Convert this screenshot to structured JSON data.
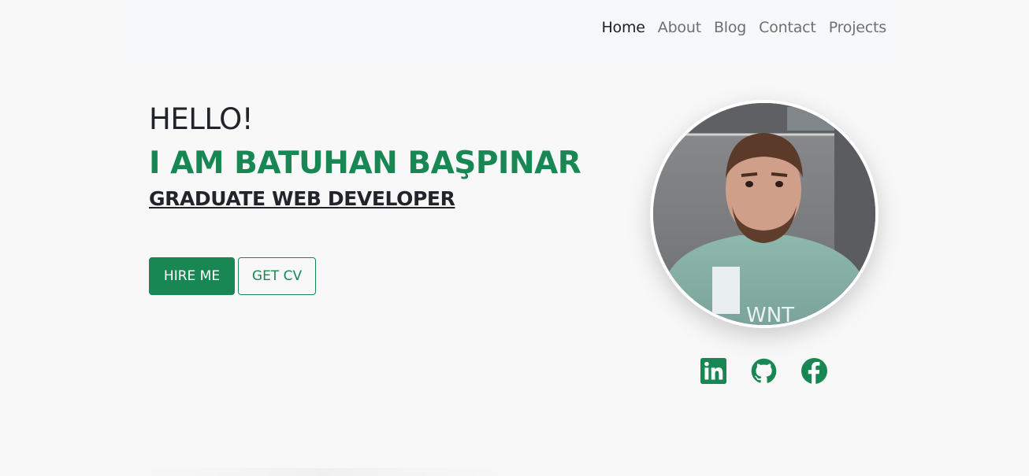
{
  "nav": {
    "items": [
      {
        "label": "Home",
        "active": true
      },
      {
        "label": "About",
        "active": false
      },
      {
        "label": "Blog",
        "active": false
      },
      {
        "label": "Contact",
        "active": false
      },
      {
        "label": "Projects",
        "active": false
      }
    ]
  },
  "hero": {
    "greeting": "HELLO!",
    "name": "I AM BATUHAN BAŞPINAR",
    "role": "GRADUATE WEB DEVELOPER",
    "buttons": {
      "hire_label": "HIRE ME",
      "cv_label": "GET CV"
    }
  },
  "profile": {
    "photo_alt": "Profile photo"
  },
  "socials": [
    {
      "icon": "linkedin-icon"
    },
    {
      "icon": "github-icon"
    },
    {
      "icon": "facebook-icon"
    }
  ],
  "colors": {
    "accent": "#198754",
    "background": "#f8f8f9",
    "nav_active": "#1f1f1f",
    "nav_inactive": "#6f6f6f"
  }
}
